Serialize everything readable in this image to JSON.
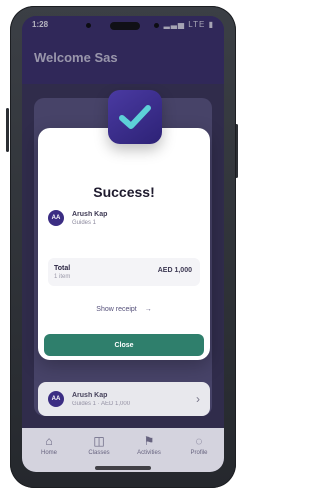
{
  "status_bar": {
    "time": "1:28",
    "icons": "▂▃▅  LTE  ▮"
  },
  "header": {
    "title": "Welcome Sas"
  },
  "success_modal": {
    "title": "Success!",
    "icon": "check-badge",
    "user": {
      "initials": "AA",
      "name": "Arush Kap",
      "subtitle": "Guides 1"
    },
    "total": {
      "label": "Total",
      "subtitle": "1 item",
      "amount": "AED 1,000"
    },
    "receipt_link": "Show receipt",
    "close_button": "Close"
  },
  "list_item": {
    "initials": "AA",
    "name": "Arush Kap",
    "subtitle": "Guides 1 · AED 1,000"
  },
  "bottom_nav": {
    "items": [
      {
        "label": "Home",
        "icon": "home-icon"
      },
      {
        "label": "Classes",
        "icon": "classes-icon"
      },
      {
        "label": "Activities",
        "icon": "activities-icon"
      },
      {
        "label": "Profile",
        "icon": "profile-icon"
      }
    ]
  },
  "colors": {
    "brand_purple": "#3a2f6b",
    "success_badge": "#4a3aa2",
    "primary_button": "#2f7f6c"
  }
}
